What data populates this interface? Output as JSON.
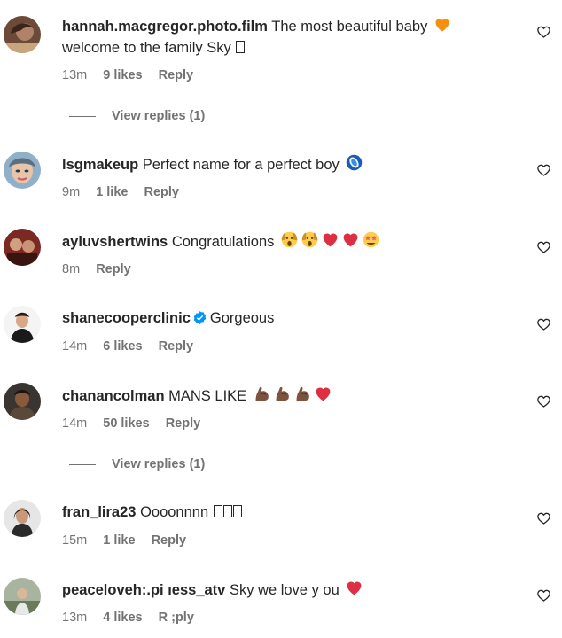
{
  "comments": [
    {
      "username": "hannah.macgregor.photo.film",
      "text": "The most beautiful baby",
      "text2": "welcome to the family Sky",
      "time": "13m",
      "likes": "9 likes",
      "reply": "Reply",
      "view_replies": "View replies (1)",
      "emojis": [
        "orange-heart"
      ]
    },
    {
      "username": "lsgmakeup",
      "text": "Perfect name for a perfect boy",
      "time": "9m",
      "likes": "1 like",
      "reply": "Reply",
      "emojis": [
        "blue-circle"
      ]
    },
    {
      "username": "ayluvshertwins",
      "text": "Congratulations",
      "time": "8m",
      "reply": "Reply",
      "emojis": [
        "screaming-face",
        "screaming-face",
        "red-heart",
        "red-heart",
        "star-struck"
      ]
    },
    {
      "username": "shanecooperclinic",
      "text": "Gorgeous",
      "time": "14m",
      "likes": "6 likes",
      "reply": "Reply",
      "verified": true
    },
    {
      "username": "chanancolman",
      "text": "MANS LIKE",
      "time": "14m",
      "likes": "50 likes",
      "reply": "Reply",
      "view_replies": "View replies (1)",
      "emojis": [
        "flexed-biceps",
        "flexed-biceps",
        "flexed-biceps",
        "red-heart"
      ]
    },
    {
      "username": "fran_lira23",
      "text": "Oooonnnn",
      "time": "15m",
      "likes": "1 like",
      "reply": "Reply"
    },
    {
      "username": "peaceloveh:.pi ıess_atv",
      "text": "Sky we love y ou",
      "time": "13m",
      "likes": "4 likes",
      "reply": "R ;ply",
      "emojis": [
        "red-heart"
      ]
    }
  ],
  "colors": {
    "text": "#262626",
    "meta": "#737373",
    "verified": "#0095f6",
    "heart": "#e0245e"
  },
  "icons": {
    "like": "heart-outline-icon"
  }
}
